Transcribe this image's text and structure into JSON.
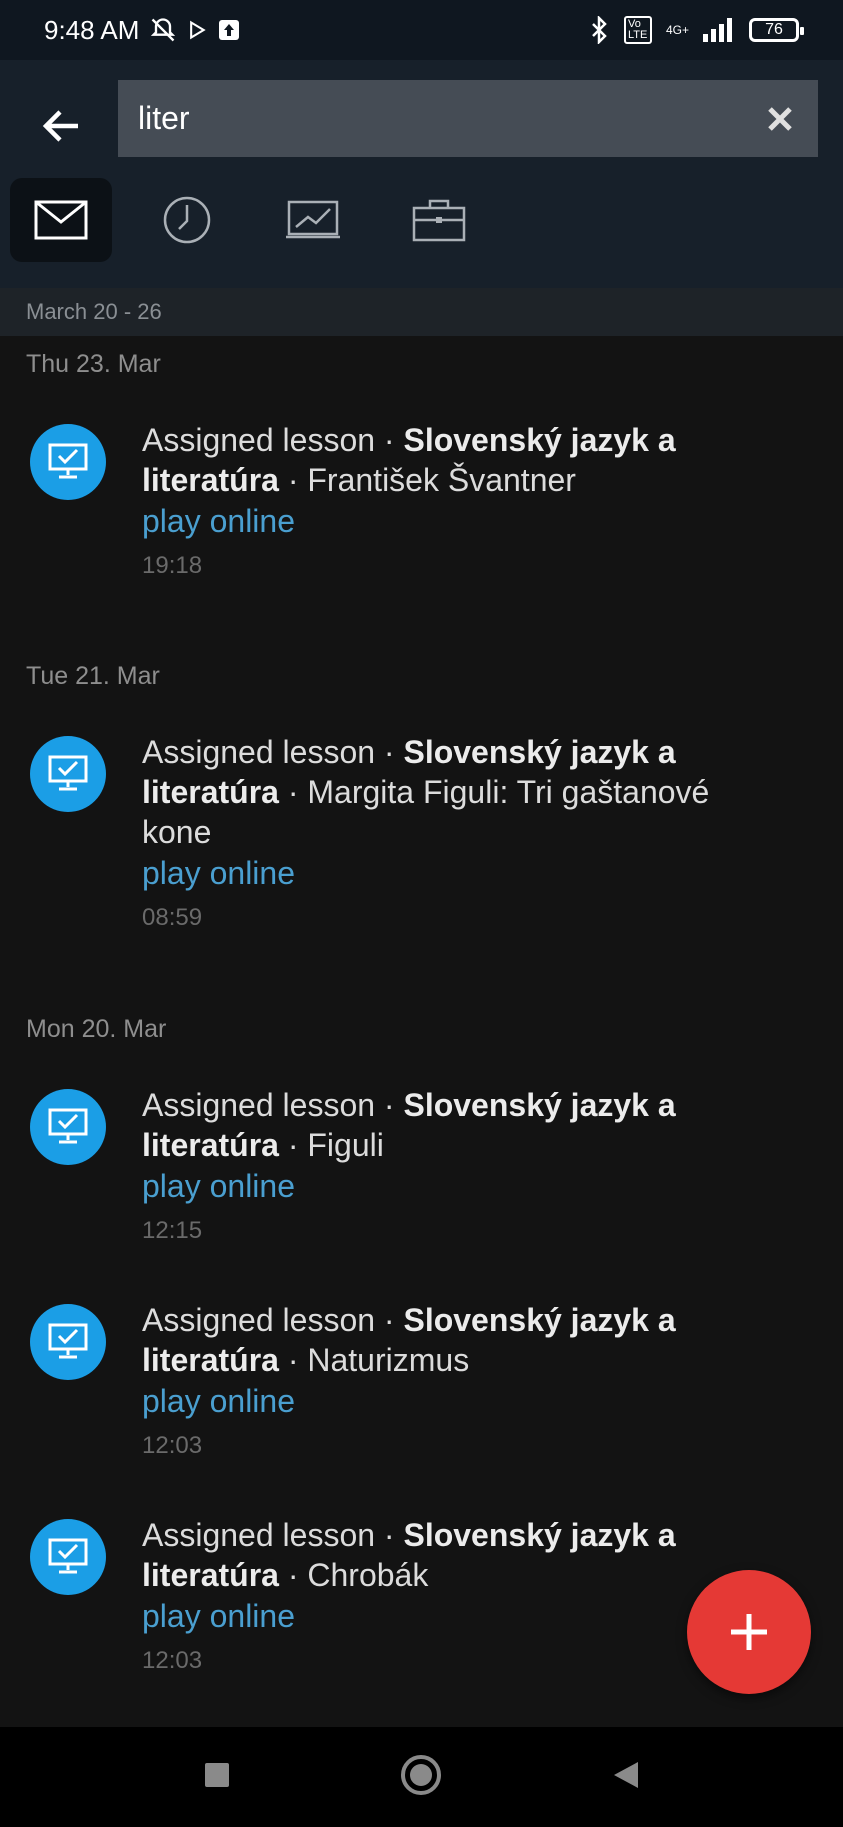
{
  "status": {
    "time": "9:48 AM",
    "network": "4G+",
    "volte": "Vo LTE",
    "battery": "76"
  },
  "search": {
    "value": "liter",
    "placeholder": ""
  },
  "filters": [
    {
      "icon": "mail-icon",
      "active": true
    },
    {
      "icon": "clock-icon",
      "active": false
    },
    {
      "icon": "presentation-icon",
      "active": false
    },
    {
      "icon": "briefcase-icon",
      "active": false
    }
  ],
  "week_header": "March 20 - 26",
  "days": [
    {
      "label": "Thu 23. Mar"
    },
    {
      "label": "Tue 21. Mar"
    },
    {
      "label": "Mon 20. Mar"
    }
  ],
  "items": [
    {
      "prefix": "Assigned lesson · ",
      "subject": "Slovenský jazyk a literatúra",
      "suffix": " · František Švantner",
      "action": "play online",
      "time": "19:18"
    },
    {
      "prefix": "Assigned lesson · ",
      "subject": "Slovenský jazyk a literatúra",
      "suffix": " · Margita Figuli: Tri gaštanové kone",
      "action": "play online",
      "time": "08:59"
    },
    {
      "prefix": "Assigned lesson · ",
      "subject": "Slovenský jazyk a literatúra",
      "suffix": " · Figuli",
      "action": "play online",
      "time": "12:15"
    },
    {
      "prefix": "Assigned lesson · ",
      "subject": "Slovenský jazyk a literatúra",
      "suffix": " · Naturizmus",
      "action": "play online",
      "time": "12:03"
    },
    {
      "prefix": "Assigned lesson · ",
      "subject": "Slovenský jazyk a literatúra",
      "suffix": " · Chrobák",
      "action": "play online",
      "time": "12:03"
    }
  ],
  "colors": {
    "accent": "#1b9ee6",
    "link": "#4a9fd0",
    "fab": "#e53935"
  }
}
